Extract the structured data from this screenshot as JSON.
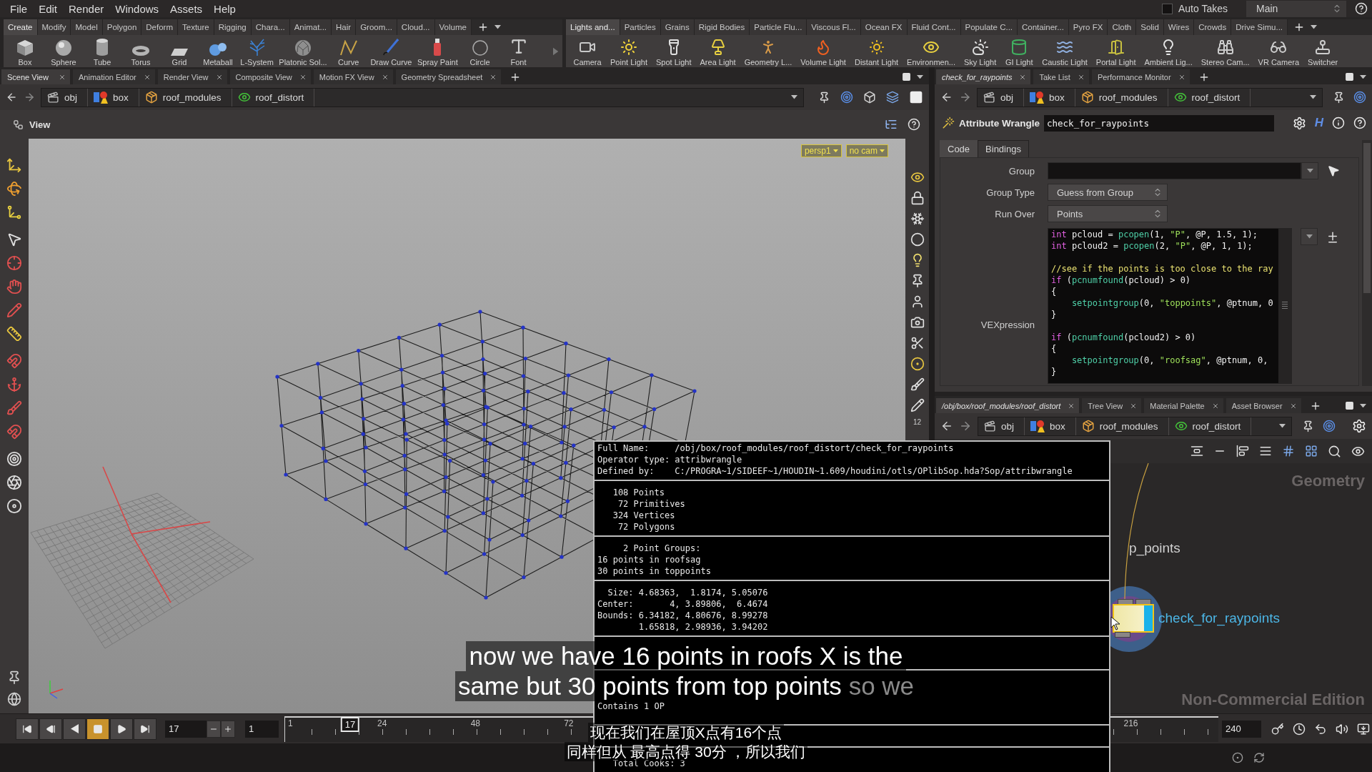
{
  "menu_bar": [
    "File",
    "Edit",
    "Render",
    "Windows",
    "Assets",
    "Help"
  ],
  "takes": {
    "auto_takes": {
      "label": "Auto Takes",
      "checked": false
    },
    "current_take": "Main"
  },
  "shelves": [
    {
      "tabs": [
        {
          "label": "Create",
          "selected": true
        },
        {
          "label": "Modify",
          "selected": false
        },
        {
          "label": "Model",
          "selected": false
        },
        {
          "label": "Polygon",
          "selected": false
        },
        {
          "label": "Deform",
          "selected": false
        },
        {
          "label": "Texture",
          "selected": false
        },
        {
          "label": "Rigging",
          "selected": false
        },
        {
          "label": "Chara...",
          "selected": false
        },
        {
          "label": "Animat...",
          "selected": false
        },
        {
          "label": "Hair",
          "selected": false
        },
        {
          "label": "Groom...",
          "selected": false
        },
        {
          "label": "Cloud...",
          "selected": false
        },
        {
          "label": "Volume",
          "selected": false
        }
      ],
      "tools": [
        "Box",
        "Sphere",
        "Tube",
        "Torus",
        "Grid",
        "Metaball",
        "L-System",
        "Platonic Sol...",
        "Curve",
        "Draw Curve",
        "Spray Paint",
        "Circle",
        "Font"
      ]
    },
    {
      "tabs": [
        {
          "label": "Lights and...",
          "selected": true
        },
        {
          "label": "Particles",
          "selected": false
        },
        {
          "label": "Grains",
          "selected": false
        },
        {
          "label": "Rigid Bodies",
          "selected": false
        },
        {
          "label": "Particle Flu...",
          "selected": false
        },
        {
          "label": "Viscous Fl...",
          "selected": false
        },
        {
          "label": "Ocean FX",
          "selected": false
        },
        {
          "label": "Fluid Cont...",
          "selected": false
        },
        {
          "label": "Populate C...",
          "selected": false
        },
        {
          "label": "Container...",
          "selected": false
        },
        {
          "label": "Pyro FX",
          "selected": false
        },
        {
          "label": "Cloth",
          "selected": false
        },
        {
          "label": "Solid",
          "selected": false
        },
        {
          "label": "Wires",
          "selected": false
        },
        {
          "label": "Crowds",
          "selected": false
        },
        {
          "label": "Drive Simu...",
          "selected": false
        }
      ],
      "tools": [
        "Camera",
        "Point Light",
        "Spot Light",
        "Area Light",
        "Geometry L...",
        "Volume Light",
        "Distant Light",
        "Environmen...",
        "Sky Light",
        "GI Light",
        "Caustic Light",
        "Portal Light",
        "Ambient Lig...",
        "Stereo Cam...",
        "VR Camera",
        "Switcher"
      ]
    }
  ],
  "scene_pane": {
    "tabs": [
      {
        "label": "Scene View",
        "selected": true,
        "linked": false
      },
      {
        "label": "Animation Editor",
        "selected": false,
        "linked": false
      },
      {
        "label": "Render View",
        "selected": false,
        "linked": false
      },
      {
        "label": "Composite View",
        "selected": false,
        "linked": false
      },
      {
        "label": "Motion FX View",
        "selected": false,
        "linked": false
      },
      {
        "label": "Geometry Spreadsheet",
        "selected": false,
        "linked": false
      }
    ],
    "path": [
      "obj",
      "box",
      "roof_modules",
      "roof_distort"
    ],
    "title": "View",
    "camera_menus": [
      "persp1",
      "no cam"
    ],
    "display_count": "12"
  },
  "parameter_pane": {
    "tabs": [
      {
        "label": "check_for_raypoints",
        "selected": true,
        "linked": true
      },
      {
        "label": "Take List",
        "selected": false,
        "linked": false
      },
      {
        "label": "Performance Monitor",
        "selected": false,
        "linked": false
      }
    ],
    "path": [
      "obj",
      "box",
      "roof_modules",
      "roof_distort"
    ],
    "node_type": "Attribute Wrangle",
    "node_name": "check_for_raypoints",
    "h_button": "H",
    "param_tabs": [
      {
        "label": "Code",
        "selected": true
      },
      {
        "label": "Bindings",
        "selected": false
      }
    ],
    "params": [
      {
        "kind": "field",
        "label": "Group"
      },
      {
        "kind": "menu",
        "label": "Group Type",
        "value": "Guess from Group"
      },
      {
        "kind": "menu",
        "label": "Run Over",
        "value": "Points"
      },
      {
        "kind": "code",
        "label": "VEXpression",
        "lines": [
          {
            "kind": "code",
            "tokens": [
              {
                "kind": "keyword",
                "text": "int"
              },
              {
                "kind": "plain",
                "text": " pcloud = "
              },
              {
                "kind": "function",
                "text": "pcopen"
              },
              {
                "kind": "plain",
                "text": "(1, "
              },
              {
                "kind": "string",
                "text": "\"P\""
              },
              {
                "kind": "plain",
                "text": ", @P, 1.5, 1);"
              }
            ]
          },
          {
            "kind": "code",
            "tokens": [
              {
                "kind": "keyword",
                "text": "int"
              },
              {
                "kind": "plain",
                "text": " pcloud2 = "
              },
              {
                "kind": "function",
                "text": "pcopen"
              },
              {
                "kind": "plain",
                "text": "(2, "
              },
              {
                "kind": "string",
                "text": "\"P\""
              },
              {
                "kind": "plain",
                "text": ", @P, 1, 1);"
              }
            ]
          },
          {
            "kind": "blank"
          },
          {
            "kind": "code",
            "tokens": [
              {
                "kind": "comment",
                "text": "//see if the points is too close to the ray"
              }
            ]
          },
          {
            "kind": "code",
            "tokens": [
              {
                "kind": "keyword",
                "text": "if"
              },
              {
                "kind": "plain",
                "text": " ("
              },
              {
                "kind": "function",
                "text": "pcnumfound"
              },
              {
                "kind": "plain",
                "text": "(pcloud) > 0)"
              }
            ]
          },
          {
            "kind": "code",
            "tokens": [
              {
                "kind": "plain",
                "text": "{"
              }
            ]
          },
          {
            "kind": "code",
            "tokens": [
              {
                "kind": "function",
                "text": "    setpointgroup"
              },
              {
                "kind": "plain",
                "text": "(0, "
              },
              {
                "kind": "string",
                "text": "\"toppoints\""
              },
              {
                "kind": "plain",
                "text": ", @ptnum, 0"
              }
            ]
          },
          {
            "kind": "code",
            "tokens": [
              {
                "kind": "plain",
                "text": "}"
              }
            ]
          },
          {
            "kind": "blank"
          },
          {
            "kind": "code",
            "tokens": [
              {
                "kind": "keyword",
                "text": "if"
              },
              {
                "kind": "plain",
                "text": " ("
              },
              {
                "kind": "function",
                "text": "pcnumfound"
              },
              {
                "kind": "plain",
                "text": "(pcloud2) > 0)"
              }
            ]
          },
          {
            "kind": "code",
            "tokens": [
              {
                "kind": "plain",
                "text": "{"
              }
            ]
          },
          {
            "kind": "code",
            "tokens": [
              {
                "kind": "function",
                "text": "    setpointgroup"
              },
              {
                "kind": "plain",
                "text": "(0, "
              },
              {
                "kind": "string",
                "text": "\"roofsag\""
              },
              {
                "kind": "plain",
                "text": ", @ptnum, 0,"
              }
            ]
          },
          {
            "kind": "code",
            "tokens": [
              {
                "kind": "plain",
                "text": "}"
              }
            ]
          }
        ]
      }
    ]
  },
  "network_pane": {
    "tabs": [
      {
        "label": "/obj/box/roof_modules/roof_distort",
        "selected": true,
        "linked": true
      },
      {
        "label": "Tree View",
        "selected": false,
        "linked": false
      },
      {
        "label": "Material Palette",
        "selected": false,
        "linked": false
      },
      {
        "label": "Asset Browser",
        "selected": false,
        "linked": false
      }
    ],
    "path": [
      "obj",
      "box",
      "roof_modules",
      "roof_distort"
    ],
    "context": "Geometry",
    "partial_node_label": "p_points",
    "node": {
      "label": "check_for_raypoints",
      "selected": true,
      "display_flag": true
    },
    "edition": "Non-Commercial Edition"
  },
  "timeline": {
    "stopped": true,
    "frame_field": "17",
    "step_field": "1",
    "ticks": [
      "1",
      "24",
      "48",
      "72",
      "216"
    ],
    "current_frame": "17",
    "end_frame": "240"
  },
  "node_info": {
    "sections": [
      [
        "Full Name:     /obj/box/roof_modules/roof_distort/check_for_raypoints",
        "Operator type: attribwrangle",
        "Defined by:    C:/PROGRA~1/SIDEEF~1/HOUDIN~1.609/houdini/otls/OPlibSop.hda?Sop/attribwrangle"
      ],
      [
        "   108 Points",
        "    72 Primitives",
        "   324 Vertices",
        "    72 Polygons"
      ],
      [
        "     2 Point Groups:",
        "16 points in roofsag",
        "30 points in toppoints"
      ],
      [
        "  Size: 4.68363,  1.8174, 5.05076",
        "Center:       4, 3.89806,  6.4674",
        "Bounds: 6.34182, 4.80676, 8.99278",
        "        1.65818, 2.98936, 3.94202"
      ],
      [
        "Contains 1 OP"
      ],
      [
        "   Total Cooks: 3"
      ]
    ]
  },
  "subtitles": {
    "english": [
      {
        "segments": [
          {
            "text": "now we have 16 points in roofs X is the",
            "faded": false
          }
        ]
      },
      {
        "segments": [
          {
            "text": "same but 30 points from top points",
            "faded": false
          },
          {
            "text": "so we",
            "faded": true
          }
        ]
      }
    ],
    "chinese": [
      "现在我们在屋顶X点有16个点",
      "同样但从 最高点得 30分 ，所以我们"
    ]
  }
}
